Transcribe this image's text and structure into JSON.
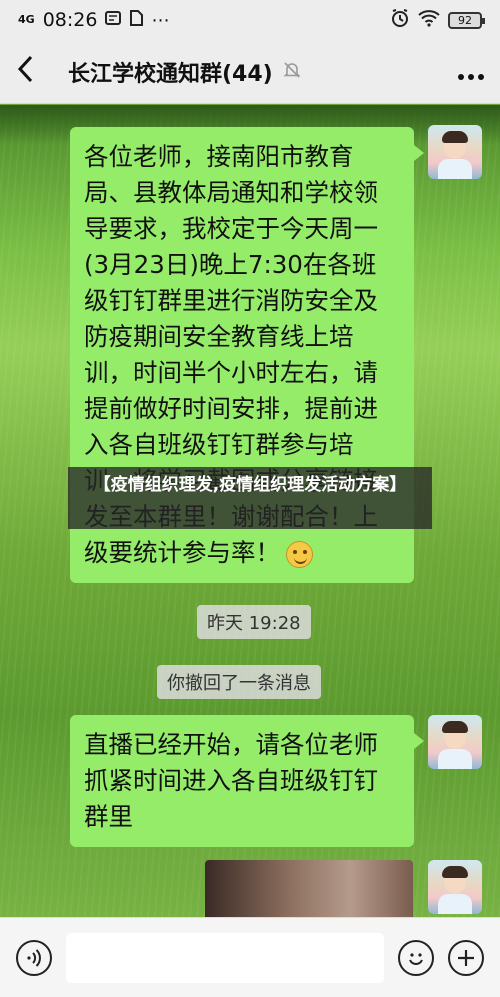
{
  "status_bar": {
    "network": "4G",
    "time": "08:26",
    "battery": "92"
  },
  "header": {
    "back_icon": "chevron-left-icon",
    "title": "长江学校通知群(44)",
    "mute_icon": "bell-slash-icon",
    "more_icon": "more-dots-icon"
  },
  "messages": [
    {
      "text": "各位老师，接南阳市教育局、县教体局通知和学校领导要求，我校定于今天周一(3月23日)晚上7:30在各班级钉钉群里进行消防安全及防疫期间安全教育线上培训，时间半个小时左右，请提前做好时间安排，提前进入各自班级钉钉群参与培训，将学习截图或分享链接发至本群里！谢谢配合！上级要统计参与率！"
    },
    {
      "text": "直播已经开始，请各位老师抓紧时间进入各自班级钉钉群里"
    }
  ],
  "timestamp": "昨天 19:28",
  "system_note": "你撤回了一条消息",
  "overlay": {
    "text": "【疫情组织理发,疫情组织理发活动方案】"
  },
  "input_bar": {
    "voice_icon": "voice-icon",
    "emoji_icon": "emoji-icon",
    "plus_icon": "plus-icon"
  }
}
